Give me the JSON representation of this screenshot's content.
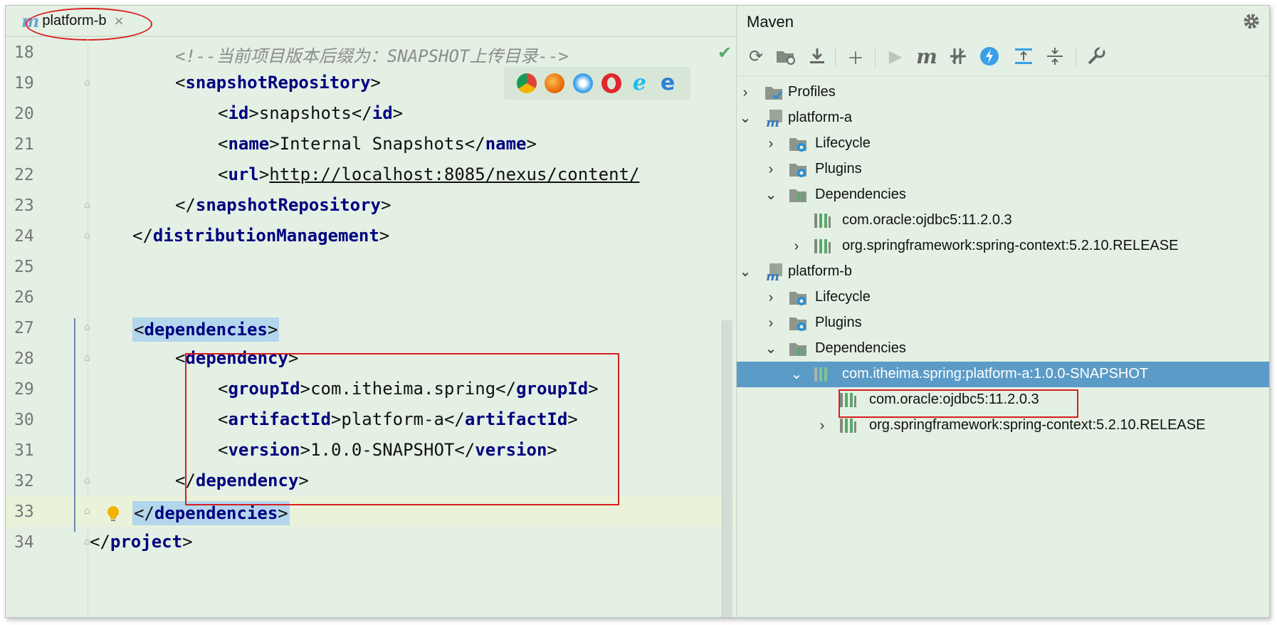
{
  "editor": {
    "tab_label": "platform-b",
    "tab_logo": "m",
    "tab_close": "×",
    "lines": [
      {
        "n": "18",
        "content": "comment"
      },
      {
        "n": "19"
      },
      {
        "n": "20"
      },
      {
        "n": "21"
      },
      {
        "n": "22"
      },
      {
        "n": "23"
      },
      {
        "n": "24"
      },
      {
        "n": "25"
      },
      {
        "n": "26"
      },
      {
        "n": "27"
      },
      {
        "n": "28"
      },
      {
        "n": "29"
      },
      {
        "n": "30"
      },
      {
        "n": "31"
      },
      {
        "n": "32"
      },
      {
        "n": "33"
      },
      {
        "n": "34"
      }
    ],
    "code": {
      "l18": "<!--当前项目版本后缀为：SNAPSHOT上传目录-->",
      "l19_tag": "snapshotRepository",
      "l20_tag": "id",
      "l20_val": "snapshots",
      "l21_tag": "name",
      "l21_val": "Internal Snapshots",
      "l22_tag": "url",
      "l22_val": "http://localhost:8085/nexus/content/",
      "l23_tag": "snapshotRepository",
      "l24_tag": "distributionManagement",
      "l27_tag": "dependencies",
      "l28_tag": "dependency",
      "l29_tag": "groupId",
      "l29_val": "com.itheima.spring",
      "l30_tag": "artifactId",
      "l30_val": "platform-a",
      "l31_tag": "version",
      "l31_val": "1.0.0-SNAPSHOT",
      "l32_tag": "dependency",
      "l33_tag": "dependencies",
      "l34_tag": "project"
    },
    "lt": "<",
    "gt": ">",
    "lts": "</"
  },
  "maven": {
    "title": "Maven",
    "tree": [
      {
        "label": "Profiles"
      },
      {
        "label": "platform-a"
      },
      {
        "label": "Lifecycle"
      },
      {
        "label": "Plugins"
      },
      {
        "label": "Dependencies"
      },
      {
        "label": "com.oracle:ojdbc5:11.2.0.3"
      },
      {
        "label": "org.springframework:spring-context:5.2.10.RELEASE"
      },
      {
        "label": "platform-b"
      },
      {
        "label": "Lifecycle"
      },
      {
        "label": "Plugins"
      },
      {
        "label": "Dependencies"
      },
      {
        "label": "com.itheima.spring:platform-a:1.0.0-SNAPSHOT"
      },
      {
        "label": "com.oracle:ojdbc5:11.2.0.3"
      },
      {
        "label": "org.springframework:spring-context:5.2.10.RELEASE"
      }
    ]
  },
  "colors": {
    "highlight_red": "#d81e1e",
    "selection": "#5b9bc7",
    "tag": "#000080",
    "background": "#e4f0e4"
  }
}
